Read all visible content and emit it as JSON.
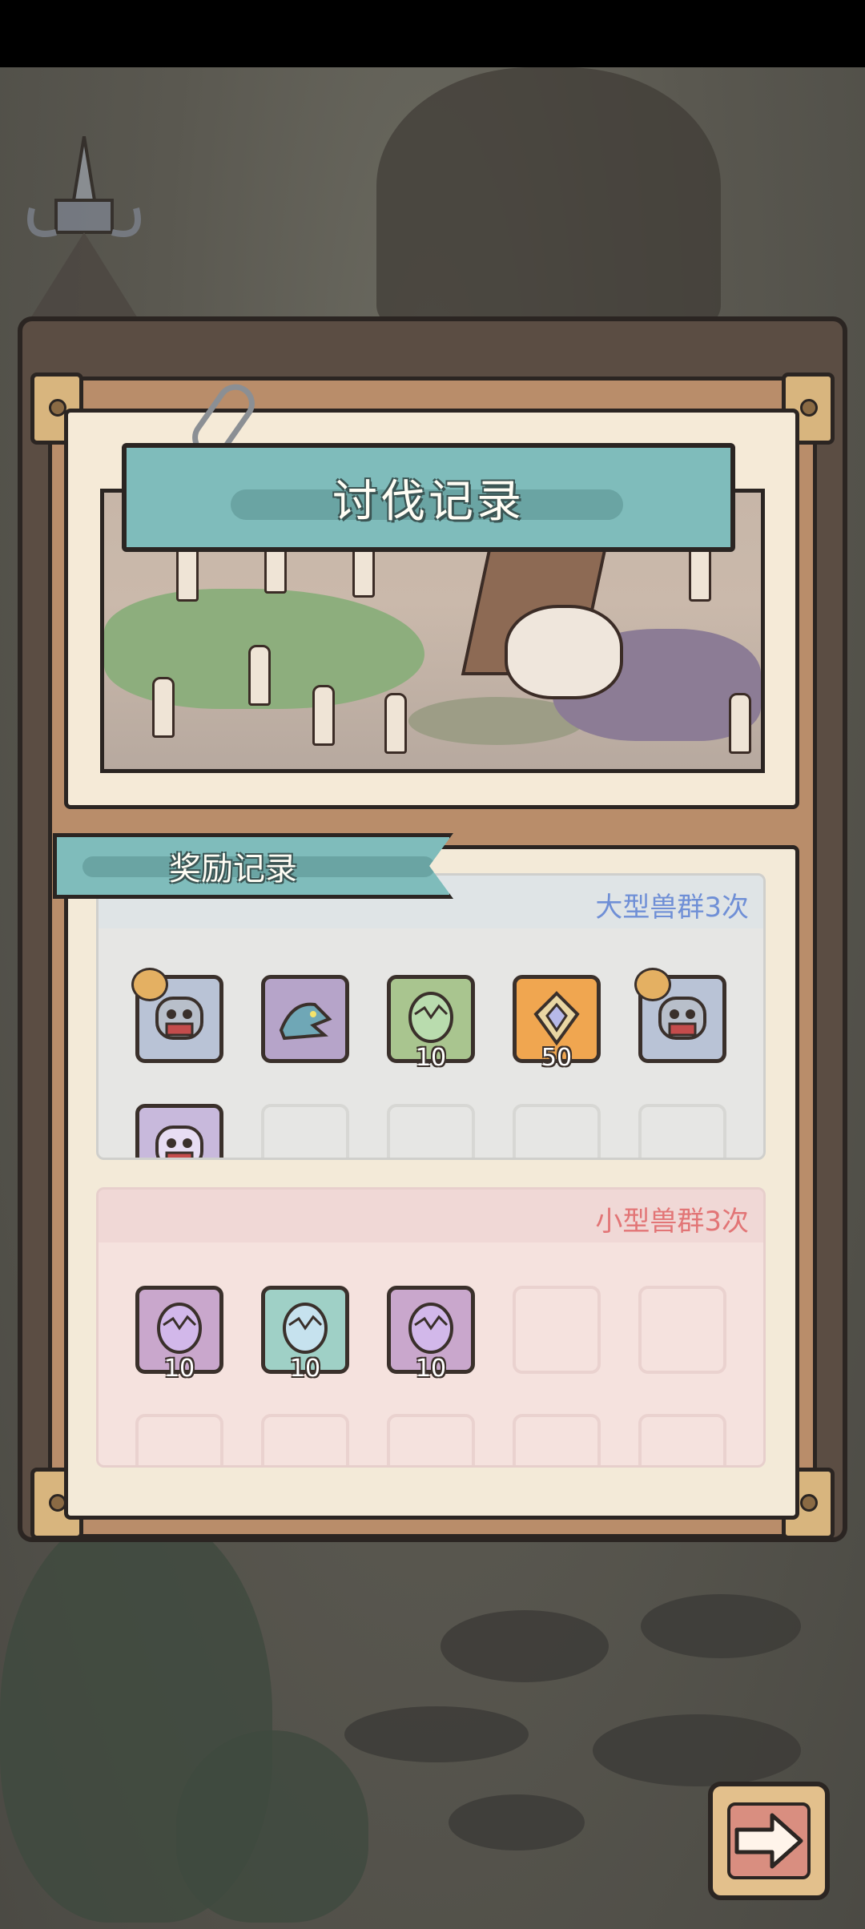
{
  "title": "讨伐记录",
  "reward_record_label": "奖励记录",
  "large_group": {
    "count_text": "大型兽群3次",
    "items": [
      {
        "icon": "zombie-beast-icon",
        "bg": "#b9c3d6",
        "badge": true,
        "amount": ""
      },
      {
        "icon": "dragon-beast-icon",
        "bg": "#b6a4c9",
        "badge": false,
        "amount": ""
      },
      {
        "icon": "green-egg-icon",
        "bg": "#a9c58f",
        "badge": false,
        "amount": "10"
      },
      {
        "icon": "crystal-shard-icon",
        "bg": "#f0a650",
        "badge": false,
        "amount": "50"
      },
      {
        "icon": "zombie-beast-icon",
        "bg": "#b9c3d6",
        "badge": true,
        "amount": ""
      },
      {
        "icon": "purple-beast-icon",
        "bg": "#c8b9dc",
        "badge": false,
        "amount": ""
      }
    ]
  },
  "small_group": {
    "count_text": "小型兽群3次",
    "items": [
      {
        "icon": "purple-egg-icon",
        "bg": "#c9a7cc",
        "amount": "10"
      },
      {
        "icon": "blue-egg-icon",
        "bg": "#9fd0c6",
        "amount": "10"
      },
      {
        "icon": "purple-egg-icon",
        "bg": "#c9a7cc",
        "amount": "10"
      }
    ]
  },
  "next_button": {
    "icon": "arrow-right-icon"
  }
}
